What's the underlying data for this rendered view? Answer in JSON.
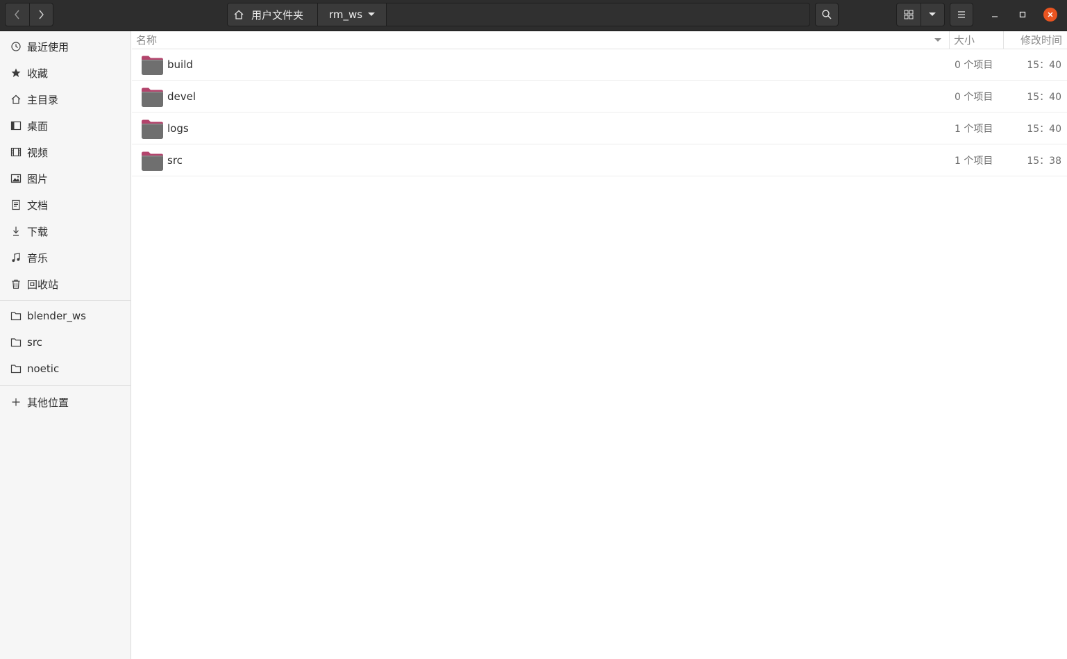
{
  "header": {
    "breadcrumb_home": "用户文件夹",
    "breadcrumb_current": "rm_ws"
  },
  "sidebar": {
    "places": [
      {
        "label": "最近使用",
        "icon": "clock-icon"
      },
      {
        "label": "收藏",
        "icon": "star-icon"
      },
      {
        "label": "主目录",
        "icon": "home-icon"
      },
      {
        "label": "桌面",
        "icon": "desktop-icon"
      },
      {
        "label": "视频",
        "icon": "film-icon"
      },
      {
        "label": "图片",
        "icon": "image-icon"
      },
      {
        "label": "文档",
        "icon": "document-icon"
      },
      {
        "label": "下载",
        "icon": "download-icon"
      },
      {
        "label": "音乐",
        "icon": "music-icon"
      },
      {
        "label": "回收站",
        "icon": "trash-icon"
      }
    ],
    "bookmarks": [
      {
        "label": "blender_ws",
        "icon": "folder-icon"
      },
      {
        "label": "src",
        "icon": "folder-icon"
      },
      {
        "label": "noetic",
        "icon": "folder-icon"
      }
    ],
    "other_locations": {
      "label": "其他位置",
      "icon": "plus-icon"
    }
  },
  "columns": {
    "name": "名称",
    "size": "大小",
    "modified": "修改时间"
  },
  "files": [
    {
      "name": "build",
      "size": "0 个项目",
      "modified": "15：40"
    },
    {
      "name": "devel",
      "size": "0 个项目",
      "modified": "15：40"
    },
    {
      "name": "logs",
      "size": "1 个项目",
      "modified": "15：40"
    },
    {
      "name": "src",
      "size": "1 个项目",
      "modified": "15：38"
    }
  ],
  "colors": {
    "headerbar": "#2d2d2d",
    "close_button": "#e95420",
    "folder_body": "#6f6f6f",
    "folder_tab": "#b3446c"
  }
}
